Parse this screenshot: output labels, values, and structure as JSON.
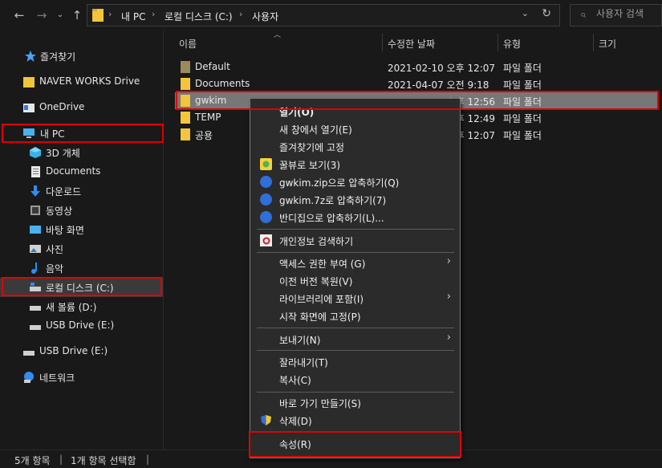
{
  "address_bar": {
    "breadcrumbs": [
      "내 PC",
      "로컬 디스크 (C:)",
      "사용자"
    ],
    "search_placeholder": "사용자 검색"
  },
  "sidebar": {
    "items": [
      {
        "label": "즐겨찾기",
        "icon": "star-icon"
      },
      {
        "label": "NAVER WORKS Drive",
        "icon": "folder-icon"
      },
      {
        "label": "OneDrive",
        "icon": "onedrive-icon"
      },
      {
        "label": "내 PC",
        "icon": "pc-icon"
      },
      {
        "label": "3D 개체",
        "icon": "cube-icon"
      },
      {
        "label": "Documents",
        "icon": "document-icon"
      },
      {
        "label": "다운로드",
        "icon": "download-icon"
      },
      {
        "label": "동영상",
        "icon": "video-icon"
      },
      {
        "label": "바탕 화면",
        "icon": "desktop-icon"
      },
      {
        "label": "사진",
        "icon": "pictures-icon"
      },
      {
        "label": "음악",
        "icon": "music-icon"
      },
      {
        "label": "로컬 디스크 (C:)",
        "icon": "drive-icon"
      },
      {
        "label": "새 볼륨 (D:)",
        "icon": "drive-icon"
      },
      {
        "label": "USB Drive (E:)",
        "icon": "usb-drive-icon"
      },
      {
        "label": "USB Drive (E:)",
        "icon": "usb-drive-icon"
      },
      {
        "label": "네트워크",
        "icon": "network-icon"
      }
    ]
  },
  "columns": {
    "name": "이름",
    "date": "수정한 날짜",
    "type": "유형",
    "size": "크기"
  },
  "files": [
    {
      "name": "Default",
      "date": "2021-02-10 오후 12:07",
      "type": "파일 폴더"
    },
    {
      "name": "Documents",
      "date": "2021-04-07 오전 9:18",
      "type": "파일 폴더"
    },
    {
      "name": "gwkim",
      "date": "2021-02-10 오후 12:56",
      "type": "파일 폴더"
    },
    {
      "name": "TEMP",
      "date": "2021-02-10 오후 12:49",
      "type": "파일 폴더"
    },
    {
      "name": "공용",
      "date": "2021-02-10 오후 12:07",
      "type": "파일 폴더"
    }
  ],
  "context_menu": {
    "items": [
      "열기(O)",
      "새 창에서 열기(E)",
      "즐겨찾기에 고정",
      "꿀뷰로 보기(3)",
      "gwkim.zip으로 압축하기(Q)",
      "gwkim.7z로 압축하기(7)",
      "반디집으로 압축하기(L)...",
      "개인정보 검색하기",
      "액세스 권한 부여 (G)",
      "이전 버전 복원(V)",
      "라이브러리에 포함(I)",
      "시작 화면에 고정(P)",
      "보내기(N)",
      "잘라내기(T)",
      "복사(C)",
      "바로 가기 만들기(S)",
      "삭제(D)",
      "속성(R)"
    ]
  },
  "status": {
    "count": "5개 항목",
    "selected": "1개 항목 선택함"
  },
  "colors": {
    "highlight": "#e00000",
    "folder": "#f3c53b",
    "selected_row": "#777777"
  }
}
